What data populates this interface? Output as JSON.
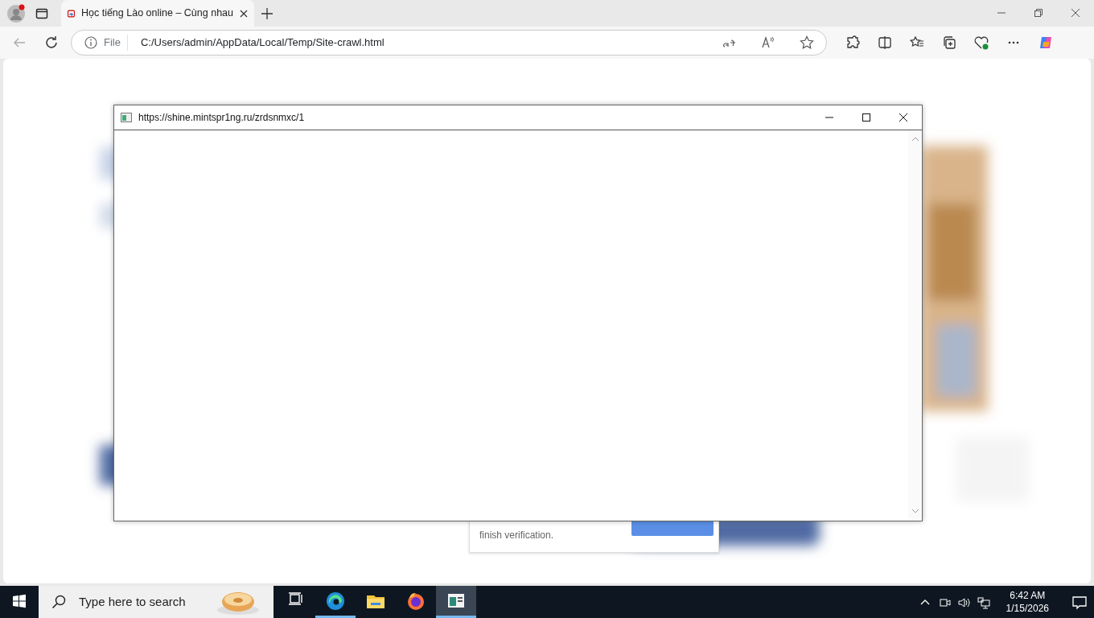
{
  "browser": {
    "tabs": [
      {
        "title": "Học tiếng Lào online – Cùng nhau",
        "selected": true
      }
    ],
    "address": {
      "scheme": "File",
      "url": "C:/Users/admin/AppData/Local/Temp/Site-crawl.html"
    }
  },
  "page": {
    "card_text": "finish verification."
  },
  "popup": {
    "title": "https://shine.mintspr1ng.ru/zrdsnmxc/1"
  },
  "taskbar": {
    "search": {
      "placeholder": "Type here to search"
    },
    "apps": [
      {
        "kind": "taskview",
        "running": false,
        "selected": false
      },
      {
        "kind": "edge",
        "running": true,
        "selected": false
      },
      {
        "kind": "explorer",
        "running": false,
        "selected": false
      },
      {
        "kind": "firefox",
        "running": false,
        "selected": false
      },
      {
        "kind": "window",
        "running": true,
        "selected": true
      }
    ],
    "time": "6:42 AM",
    "date": "1/15/2026"
  }
}
